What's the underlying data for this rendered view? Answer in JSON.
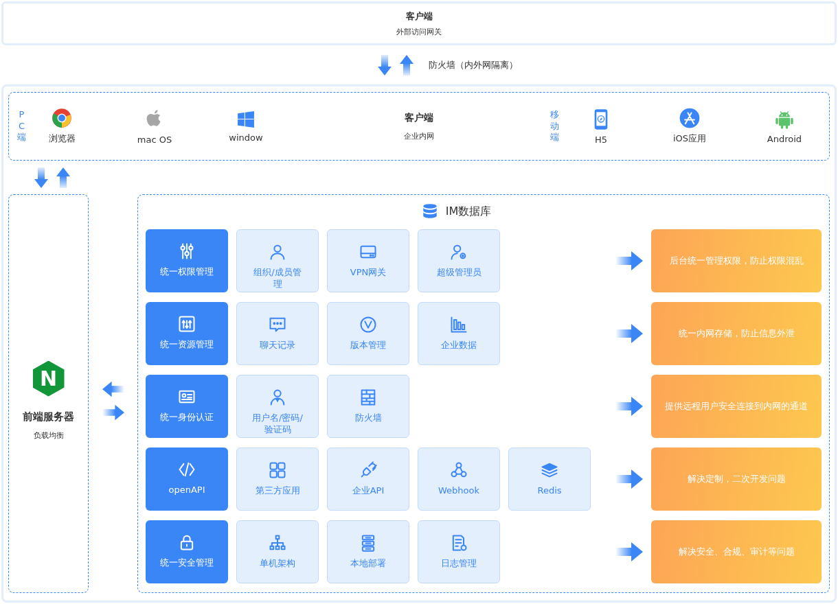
{
  "external_client": {
    "title": "客户端",
    "subtitle": "外部访问网关"
  },
  "firewall": {
    "label": "防火墙（内外网隔离）"
  },
  "intranet_client": {
    "title": "客户端",
    "subtitle": "企业内网",
    "pc": {
      "label": "PC端",
      "apps": [
        "浏览器",
        "mac OS",
        "window"
      ]
    },
    "mobile": {
      "label": "移动端",
      "apps": [
        "H5",
        "iOS应用",
        "Android"
      ]
    }
  },
  "server": {
    "logo_letter": "N",
    "title": "前端服务器",
    "subtitle": "负载均衡"
  },
  "database": {
    "title": "IM数据库",
    "rows": [
      {
        "category": "统一权限管理",
        "modules": [
          "组织/成员管理",
          "VPN网关",
          "超级管理员"
        ],
        "benefit": "后台统一管理权限，防止权限混乱"
      },
      {
        "category": "统一资源管理",
        "modules": [
          "聊天记录",
          "版本管理",
          "企业数据"
        ],
        "benefit": "统一内网存储，防止信息外泄"
      },
      {
        "category": "统一身份认证",
        "modules": [
          "用户名/密码/验证码",
          "防火墙"
        ],
        "benefit": "提供远程用户安全连接到内网的通道"
      },
      {
        "category": "openAPI",
        "modules": [
          "第三方应用",
          "企业API",
          "Webhook",
          "Redis"
        ],
        "benefit": "解决定制，二次开发问题"
      },
      {
        "category": "统一安全管理",
        "modules": [
          "单机架构",
          "本地部署",
          "日志管理"
        ],
        "benefit": "解决安全、合规、审计等问题"
      }
    ]
  }
}
